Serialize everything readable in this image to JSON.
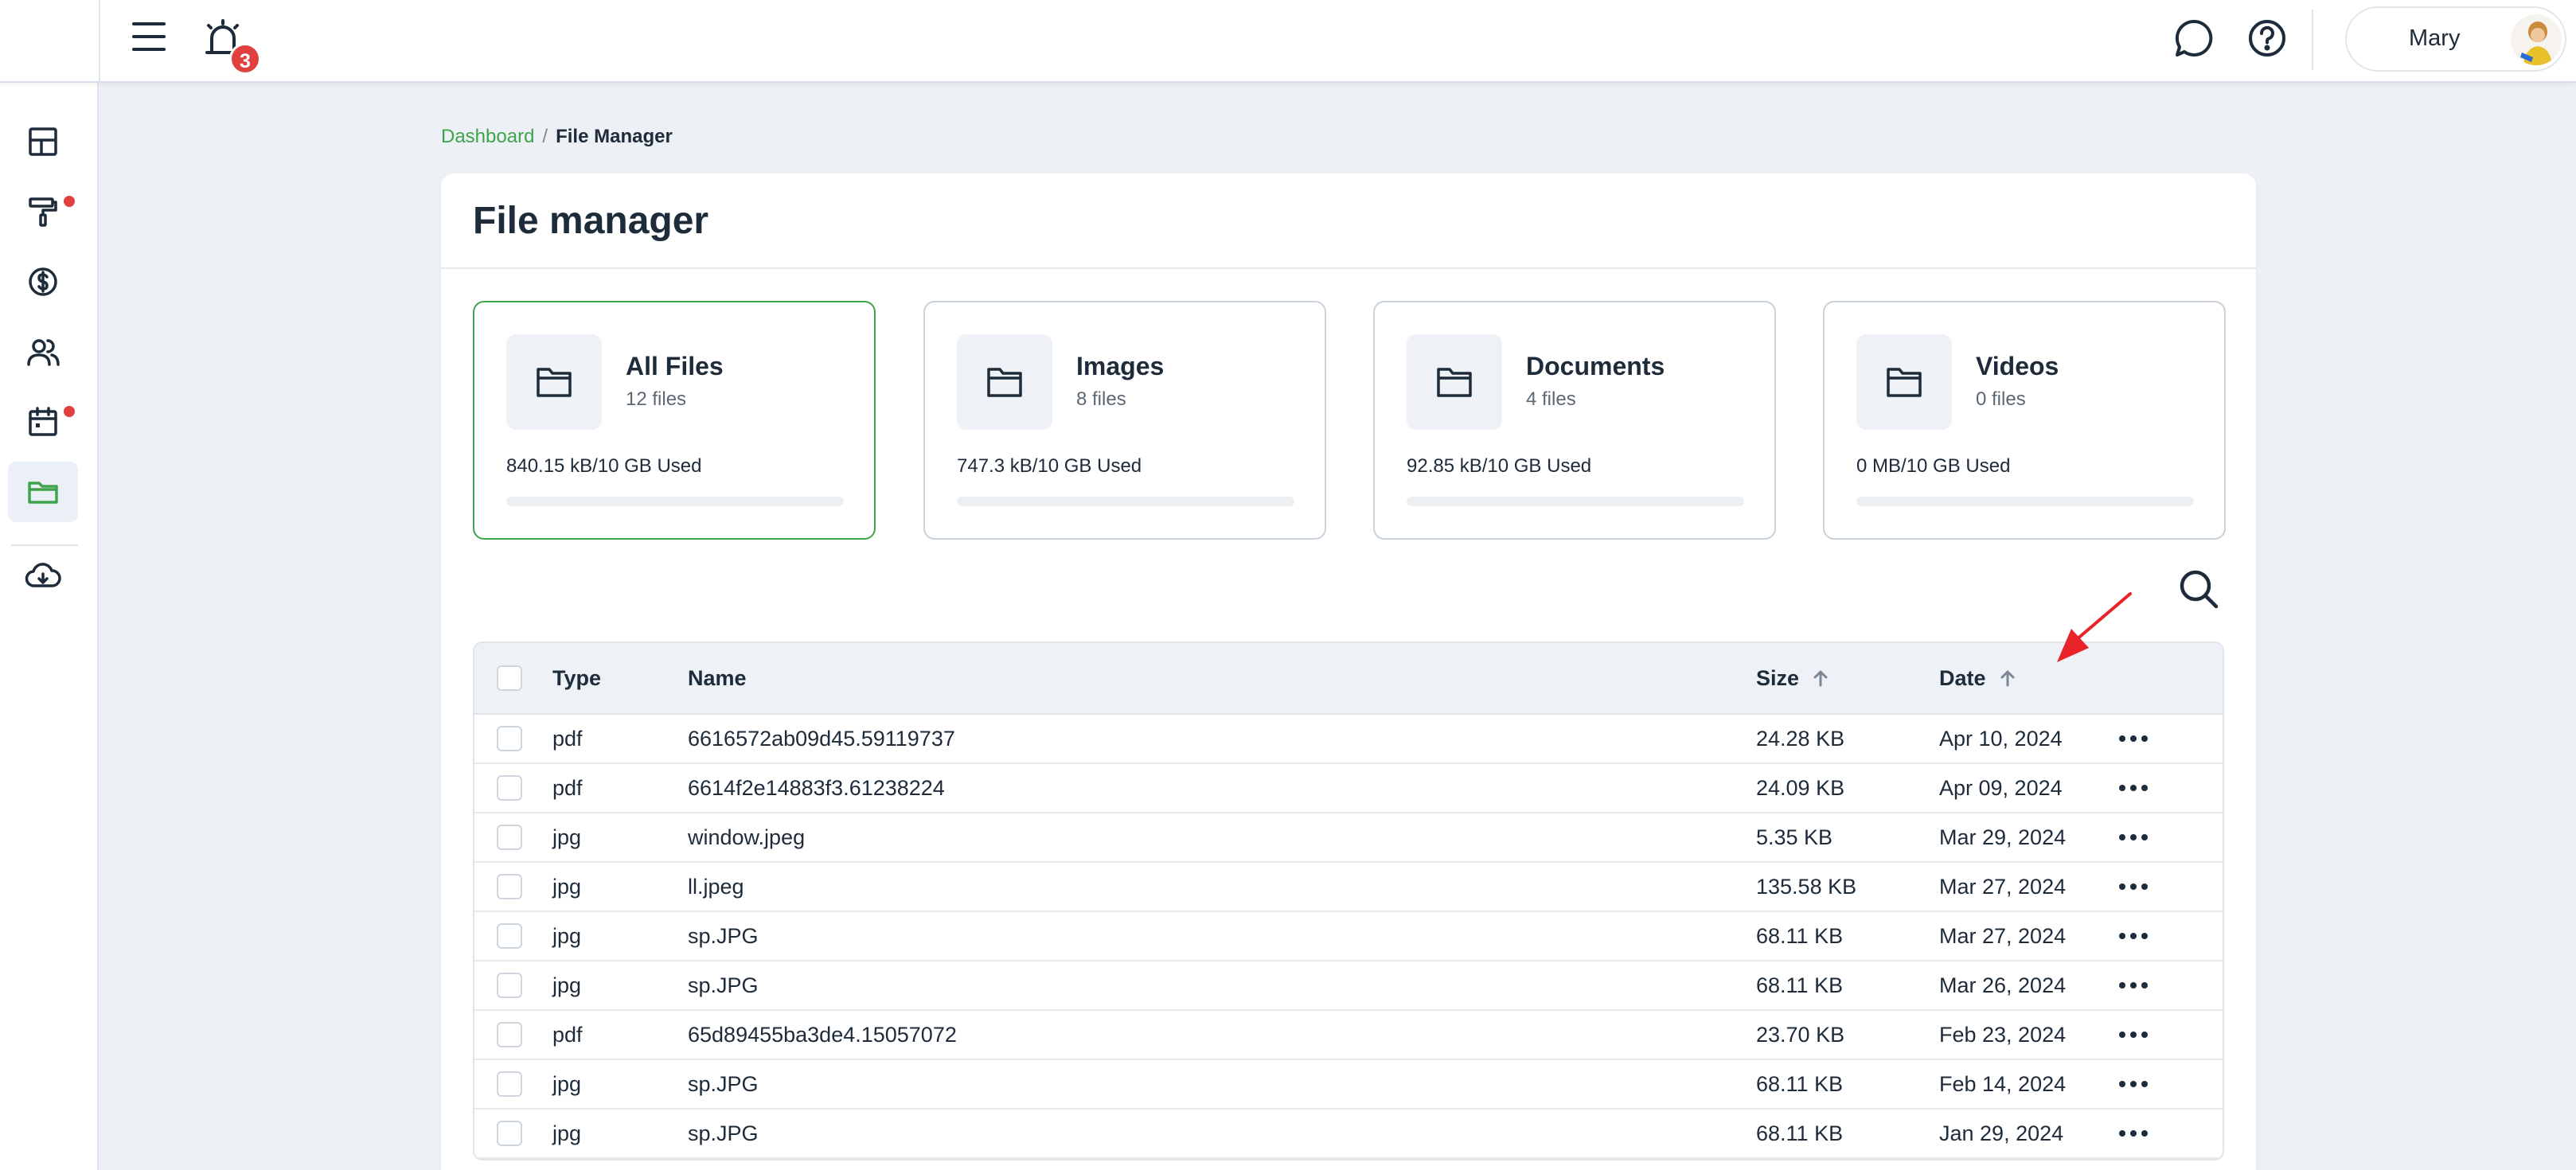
{
  "topbar": {
    "notification_count": "3",
    "user_name": "Mary"
  },
  "sidebar": {
    "items": [
      {
        "icon": "dashboard-icon",
        "has_dot": false
      },
      {
        "icon": "paint-roller-icon",
        "has_dot": true
      },
      {
        "icon": "dollar-icon",
        "has_dot": false
      },
      {
        "icon": "users-icon",
        "has_dot": false
      },
      {
        "icon": "calendar-icon",
        "has_dot": true
      },
      {
        "icon": "folder-icon",
        "active": true
      },
      {
        "icon": "cloud-download-icon",
        "has_dot": false
      }
    ]
  },
  "breadcrumb": {
    "parent": "Dashboard",
    "separator": "/",
    "current": "File Manager"
  },
  "page": {
    "title": "File manager"
  },
  "cards": [
    {
      "title": "All Files",
      "count": "12 files",
      "used": "840.15 kB/10 GB Used",
      "fraction": 0.0001
    },
    {
      "title": "Images",
      "count": "8 files",
      "used": "747.3 kB/10 GB Used",
      "fraction": 0.0001
    },
    {
      "title": "Documents",
      "count": "4 files",
      "used": "92.85 kB/10 GB Used",
      "fraction": 0.0
    },
    {
      "title": "Videos",
      "count": "0 files",
      "used": "0 MB/10 GB Used",
      "fraction": 0.0
    }
  ],
  "table": {
    "headers": {
      "type": "Type",
      "name": "Name",
      "size": "Size",
      "date": "Date"
    },
    "rows": [
      {
        "type": "pdf",
        "name": "6616572ab09d45.59119737",
        "size": "24.28 KB",
        "date": "Apr 10, 2024"
      },
      {
        "type": "pdf",
        "name": "6614f2e14883f3.61238224",
        "size": "24.09 KB",
        "date": "Apr 09, 2024"
      },
      {
        "type": "jpg",
        "name": "window.jpeg",
        "size": "5.35 KB",
        "date": "Mar 29, 2024"
      },
      {
        "type": "jpg",
        "name": "ll.jpeg",
        "size": "135.58 KB",
        "date": "Mar 27, 2024"
      },
      {
        "type": "jpg",
        "name": "sp.JPG",
        "size": "68.11 KB",
        "date": "Mar 27, 2024"
      },
      {
        "type": "jpg",
        "name": "sp.JPG",
        "size": "68.11 KB",
        "date": "Mar 26, 2024"
      },
      {
        "type": "pdf",
        "name": "65d89455ba3de4.15057072",
        "size": "23.70 KB",
        "date": "Feb 23, 2024"
      },
      {
        "type": "jpg",
        "name": "sp.JPG",
        "size": "68.11 KB",
        "date": "Feb 14, 2024"
      },
      {
        "type": "jpg",
        "name": "sp.JPG",
        "size": "68.11 KB",
        "date": "Jan 29, 2024"
      }
    ]
  },
  "colors": {
    "accent": "#3fa34d",
    "badge": "#e1413e",
    "annotation": "#e8232a"
  }
}
